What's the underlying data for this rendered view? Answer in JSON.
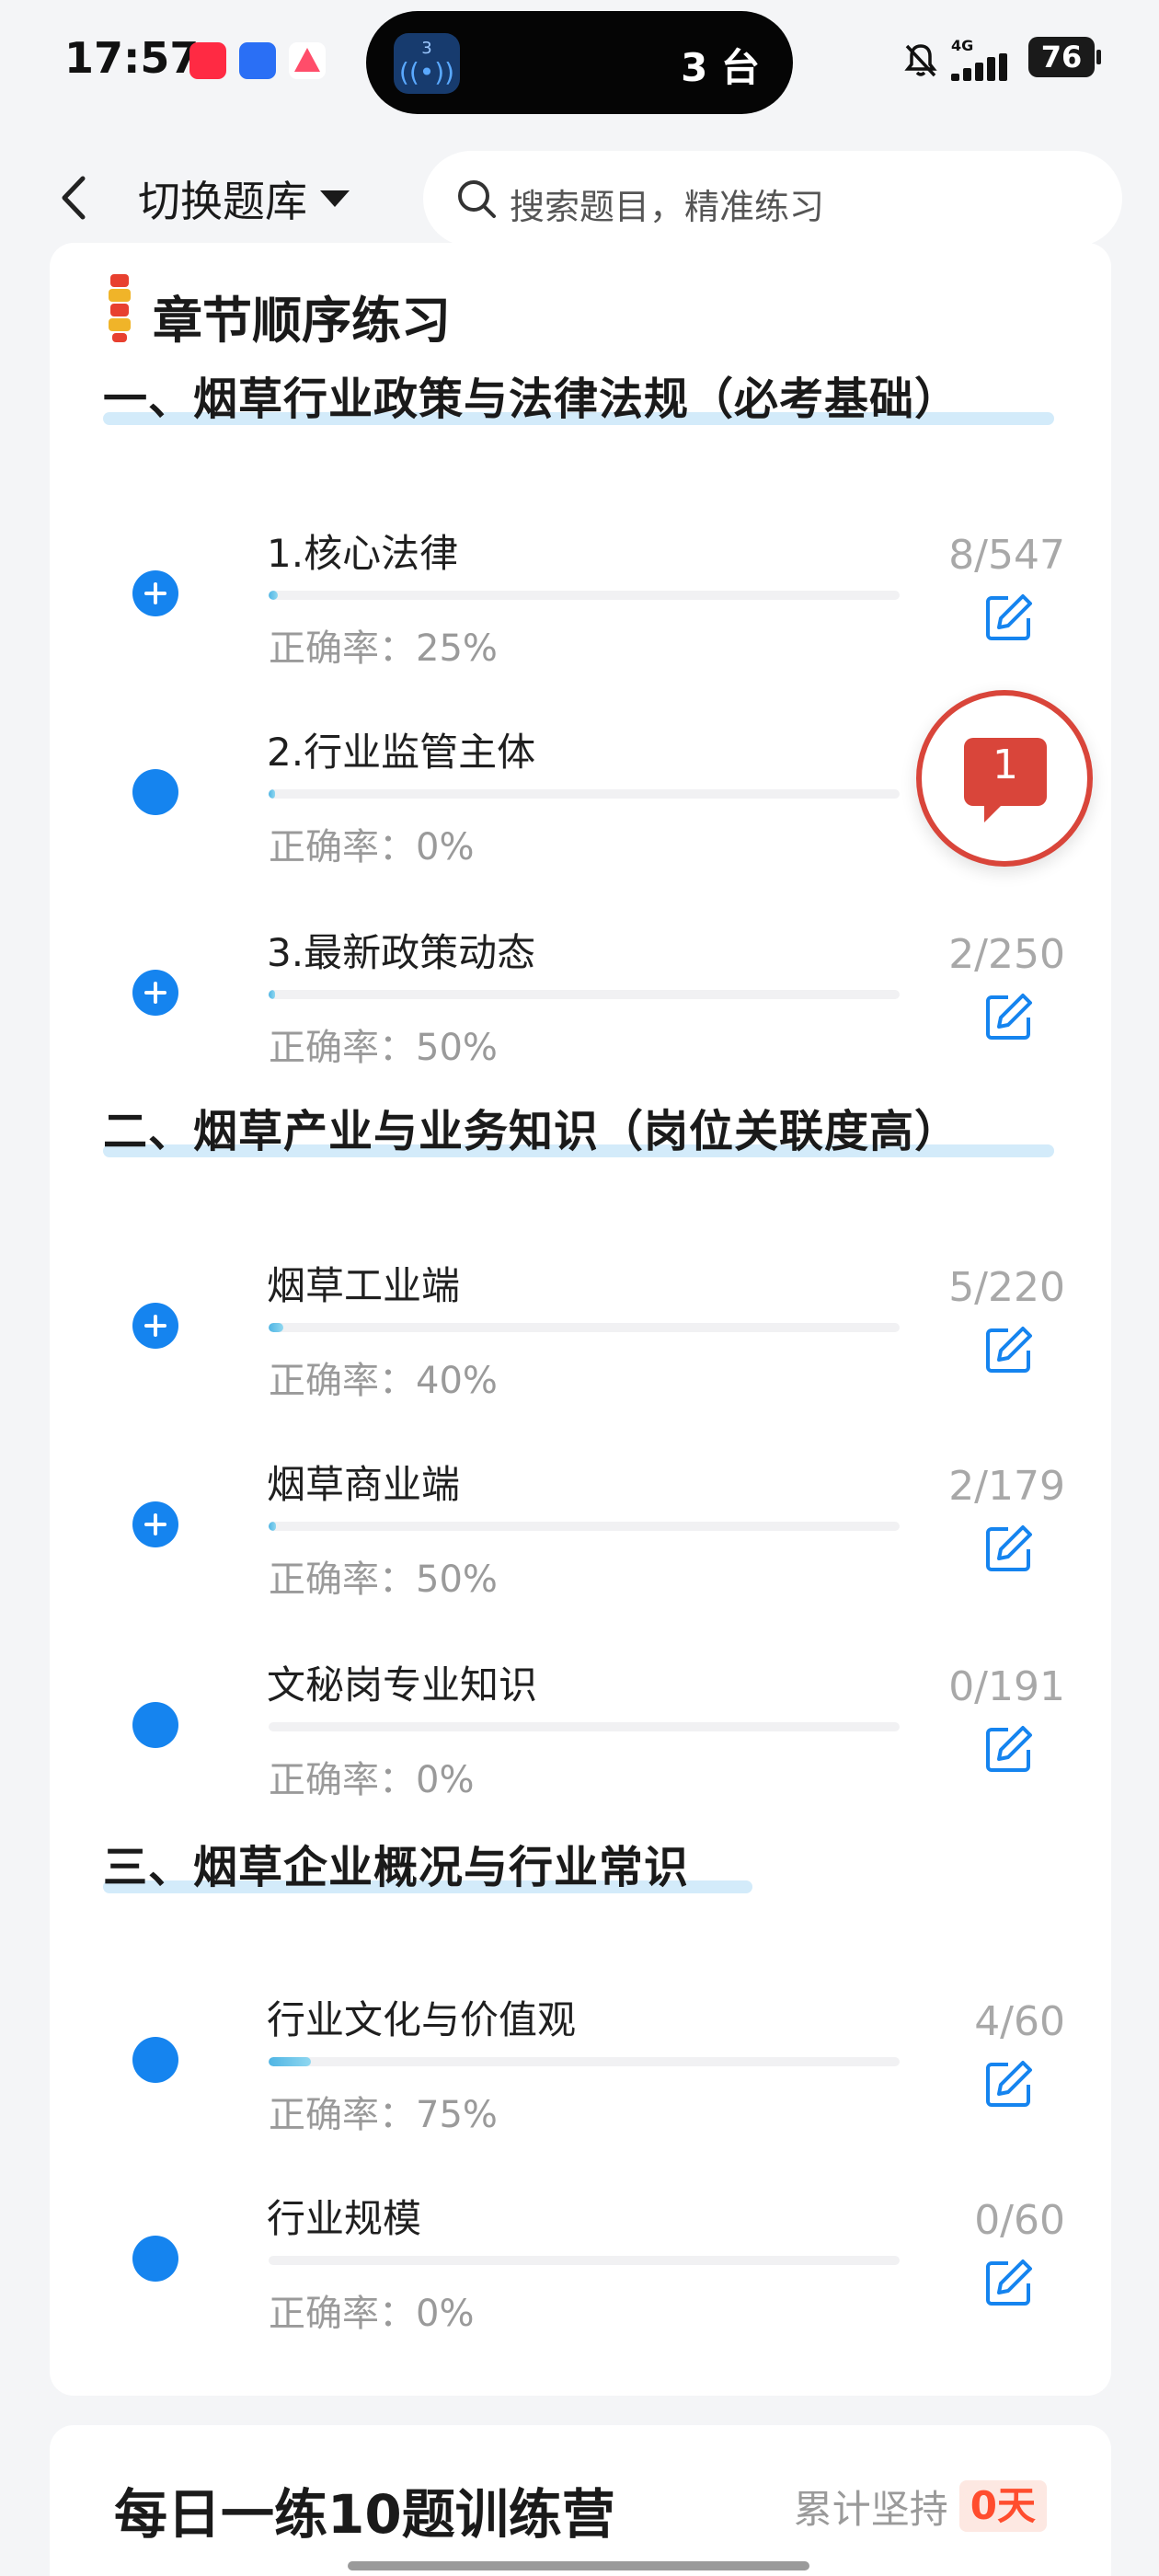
{
  "status_bar": {
    "time": "17:57",
    "live_activity_count": "3",
    "live_activity_text": "3 台",
    "network": "4G",
    "battery": "76"
  },
  "nav": {
    "bank_switch_label": "切换题库",
    "search_placeholder": "搜索题目，精准练习"
  },
  "chapter_card": {
    "title": "章节顺序练习",
    "accuracy_label": "正确率：",
    "sections": [
      {
        "title": "一、烟草行业政策与法律法规（必考基础）",
        "items": [
          {
            "name": "1.核心法律",
            "accuracy": "25%",
            "count": "8/547",
            "progress": 0.015,
            "expandable": true
          },
          {
            "name": "2.行业监管主体",
            "accuracy": "0%",
            "count": "",
            "progress": 0.005,
            "expandable": false
          },
          {
            "name": "3.最新政策动态",
            "accuracy": "50%",
            "count": "2/250",
            "progress": 0.008,
            "expandable": true
          }
        ]
      },
      {
        "title": "二、烟草产业与业务知识（岗位关联度高）",
        "items": [
          {
            "name": "烟草工业端",
            "accuracy": "40%",
            "count": "5/220",
            "progress": 0.023,
            "expandable": true
          },
          {
            "name": "烟草商业端",
            "accuracy": "50%",
            "count": "2/179",
            "progress": 0.011,
            "expandable": true
          },
          {
            "name": "文秘岗专业知识",
            "accuracy": "0%",
            "count": "0/191",
            "progress": 0.0,
            "expandable": false
          }
        ]
      },
      {
        "title": "三、烟草企业概况与行业常识",
        "items": [
          {
            "name": "行业文化与价值观",
            "accuracy": "75%",
            "count": "4/60",
            "progress": 0.067,
            "expandable": false
          },
          {
            "name": "行业规模",
            "accuracy": "0%",
            "count": "0/60",
            "progress": 0.0,
            "expandable": false
          }
        ]
      }
    ]
  },
  "feedback": {
    "count": "1"
  },
  "camp": {
    "title": "每日一练10题训练营",
    "streak_label": "累计坚持",
    "streak_value": "0天"
  },
  "colors": {
    "accent_blue": "#1584ef",
    "feedback_red": "#d9453a",
    "streak_orange": "#ff4d2e",
    "section_highlight": "#d3ebfa"
  }
}
